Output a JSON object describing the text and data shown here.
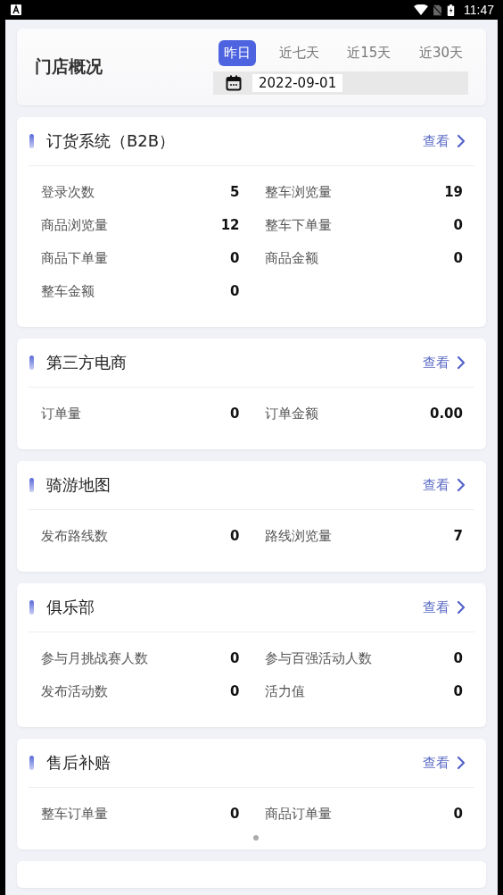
{
  "status_bar": {
    "time": "11:47"
  },
  "overview": {
    "title": "门店概况",
    "date": "2022-09-01",
    "ranges": [
      {
        "label": "昨日",
        "selected": true
      },
      {
        "label": "近七天",
        "selected": false
      },
      {
        "label": "近15天",
        "selected": false
      },
      {
        "label": "近30天",
        "selected": false
      }
    ]
  },
  "sections": [
    {
      "title": "订货系统（B2B）",
      "link": "查看",
      "stats": [
        {
          "label": "登录次数",
          "value": "5"
        },
        {
          "label": "整车浏览量",
          "value": "19"
        },
        {
          "label": "商品浏览量",
          "value": "12"
        },
        {
          "label": "整车下单量",
          "value": "0"
        },
        {
          "label": "商品下单量",
          "value": "0"
        },
        {
          "label": "商品金额",
          "value": "0"
        },
        {
          "label": "整车金额",
          "value": "0"
        }
      ]
    },
    {
      "title": "第三方电商",
      "link": "查看",
      "stats": [
        {
          "label": "订单量",
          "value": "0"
        },
        {
          "label": "订单金额",
          "value": "0.00"
        }
      ]
    },
    {
      "title": "骑游地图",
      "link": "查看",
      "stats": [
        {
          "label": "发布路线数",
          "value": "0"
        },
        {
          "label": "路线浏览量",
          "value": "7"
        }
      ]
    },
    {
      "title": "俱乐部",
      "link": "查看",
      "stats": [
        {
          "label": "参与月挑战赛人数",
          "value": "0"
        },
        {
          "label": "参与百强活动人数",
          "value": "0"
        },
        {
          "label": "发布活动数",
          "value": "0"
        },
        {
          "label": "活力值",
          "value": "0"
        }
      ]
    },
    {
      "title": "售后补赔",
      "link": "查看",
      "stats": [
        {
          "label": "整车订单量",
          "value": "0"
        },
        {
          "label": "商品订单量",
          "value": "0"
        }
      ]
    }
  ]
}
